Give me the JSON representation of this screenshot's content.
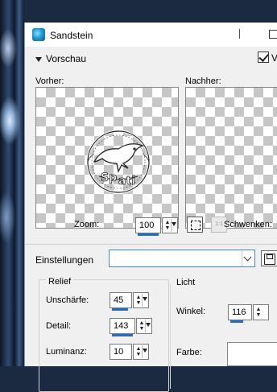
{
  "window": {
    "title": "Sandstein"
  },
  "preview": {
    "toggle_label": "Vorschau",
    "checkbox_label": "V",
    "checkbox_checked": true
  },
  "panes": {
    "before_label": "Vorher:",
    "after_label": "Nachher:"
  },
  "zoom": {
    "label": "Zoom:",
    "value": "100",
    "actual_size_label": "1:1",
    "pan_label": "Schwenken:"
  },
  "settings": {
    "label": "Einstellungen",
    "value": ""
  },
  "relief": {
    "title": "Relief",
    "blur_label": "Unschärfe:",
    "blur_value": "45",
    "detail_label": "Detail:",
    "detail_value": "143",
    "luminance_label": "Luminanz:",
    "luminance_value": "10"
  },
  "light": {
    "title": "Licht",
    "angle_label": "Winkel:",
    "angle_value": "116",
    "color_label": "Farbe:",
    "color_value": "#ffffff"
  },
  "icons": {
    "app": "paintshop-icon",
    "toggle": "triangle-down-icon",
    "fit": "fit-window-icon",
    "actual": "actual-size-icon",
    "save": "save-icon",
    "dropdown": "chevron-down-icon"
  },
  "colors": {
    "accent": "#1d6fc9",
    "checker": "#c6c6c6",
    "focus_border": "#3c8ad6"
  }
}
